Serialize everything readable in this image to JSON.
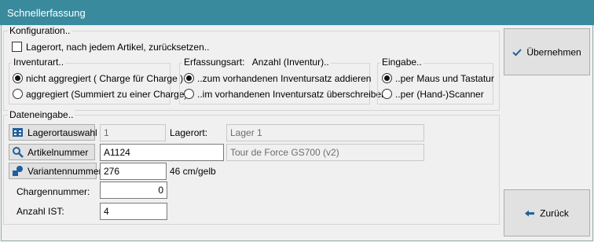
{
  "window": {
    "title": "Schnellerfassung"
  },
  "config": {
    "legend": "Konfiguration..",
    "reset_location_label": "Lagerort, nach jedem Artikel, zurücksetzen..",
    "reset_location_checked": false
  },
  "inventory_type": {
    "legend": "Inventurart..",
    "options": [
      {
        "label": "nicht aggregiert ( Charge für Charge )",
        "selected": true
      },
      {
        "label": "aggregiert (Summiert zu einer Charge)",
        "selected": false
      }
    ]
  },
  "capture_type": {
    "legend": "Erfassungsart:   Anzahl (Inventur)..",
    "options": [
      {
        "label": "..zum vorhandenen Inventursatz addieren",
        "selected": true
      },
      {
        "label": "..im vorhandenen Inventursatz überschreiben",
        "selected": false
      }
    ]
  },
  "input_mode": {
    "legend": "Eingabe..",
    "options": [
      {
        "label": "..per Maus und Tastatur",
        "selected": true
      },
      {
        "label": "..per (Hand-)Scanner",
        "selected": false
      }
    ]
  },
  "data_entry": {
    "legend": "Dateneingabe..",
    "location_button": "Lagerortauswahl",
    "location_id": "1",
    "location_label": "Lagerort:",
    "location_name": "Lager 1",
    "article_button": "Artikelnummer",
    "article_number": "A1124",
    "article_name": "Tour de Force GS700 (v2)",
    "variant_button": "Variantennummer",
    "variant_number": "276",
    "variant_description": "46 cm/gelb",
    "batch_label": "Chargennummer:",
    "batch_number": "0",
    "quantity_label": "Anzahl IST:",
    "quantity": "4"
  },
  "actions": {
    "apply_label": "Übernehmen",
    "back_label": "Zurück"
  },
  "colors": {
    "titlebar": "#3a8a9e",
    "icon_blue": "#1f5f9e"
  }
}
